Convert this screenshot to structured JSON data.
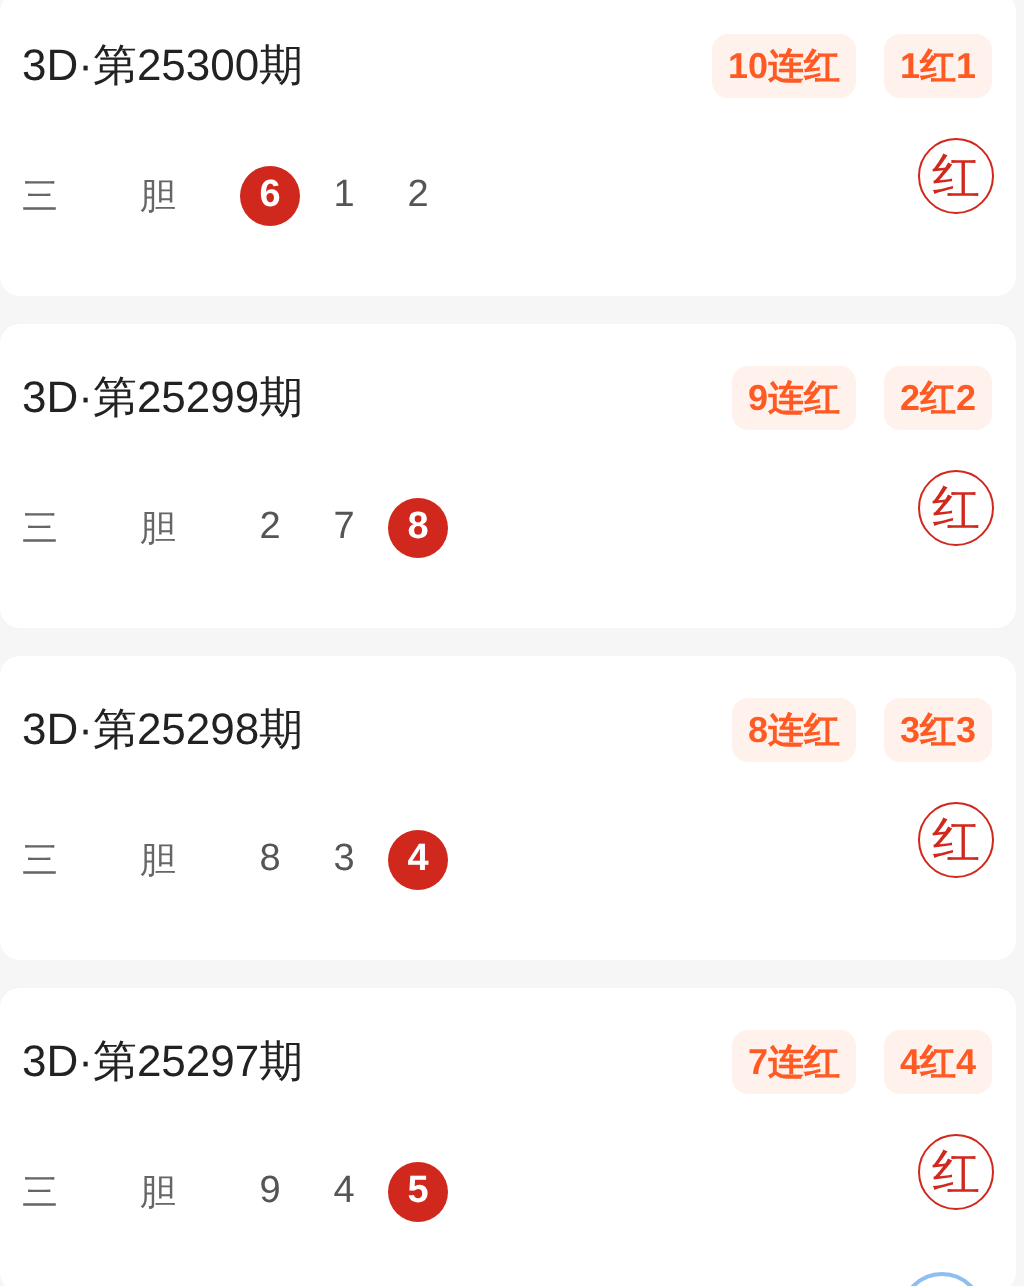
{
  "records": [
    {
      "title": "3D·第25300期",
      "badges": [
        "10连红",
        "1红1"
      ],
      "play": "三",
      "type": "胆",
      "digits": [
        {
          "value": "6",
          "hit": true
        },
        {
          "value": "1",
          "hit": false
        },
        {
          "value": "2",
          "hit": false
        }
      ],
      "result": "红"
    },
    {
      "title": "3D·第25299期",
      "badges": [
        "9连红",
        "2红2"
      ],
      "play": "三",
      "type": "胆",
      "digits": [
        {
          "value": "2",
          "hit": false
        },
        {
          "value": "7",
          "hit": false
        },
        {
          "value": "8",
          "hit": true
        }
      ],
      "result": "红"
    },
    {
      "title": "3D·第25298期",
      "badges": [
        "8连红",
        "3红3"
      ],
      "play": "三",
      "type": "胆",
      "digits": [
        {
          "value": "8",
          "hit": false
        },
        {
          "value": "3",
          "hit": false
        },
        {
          "value": "4",
          "hit": true
        }
      ],
      "result": "红"
    },
    {
      "title": "3D·第25297期",
      "badges": [
        "7连红",
        "4红4"
      ],
      "play": "三",
      "type": "胆",
      "digits": [
        {
          "value": "9",
          "hit": false
        },
        {
          "value": "4",
          "hit": false
        },
        {
          "value": "5",
          "hit": true
        }
      ],
      "result": "红"
    }
  ]
}
